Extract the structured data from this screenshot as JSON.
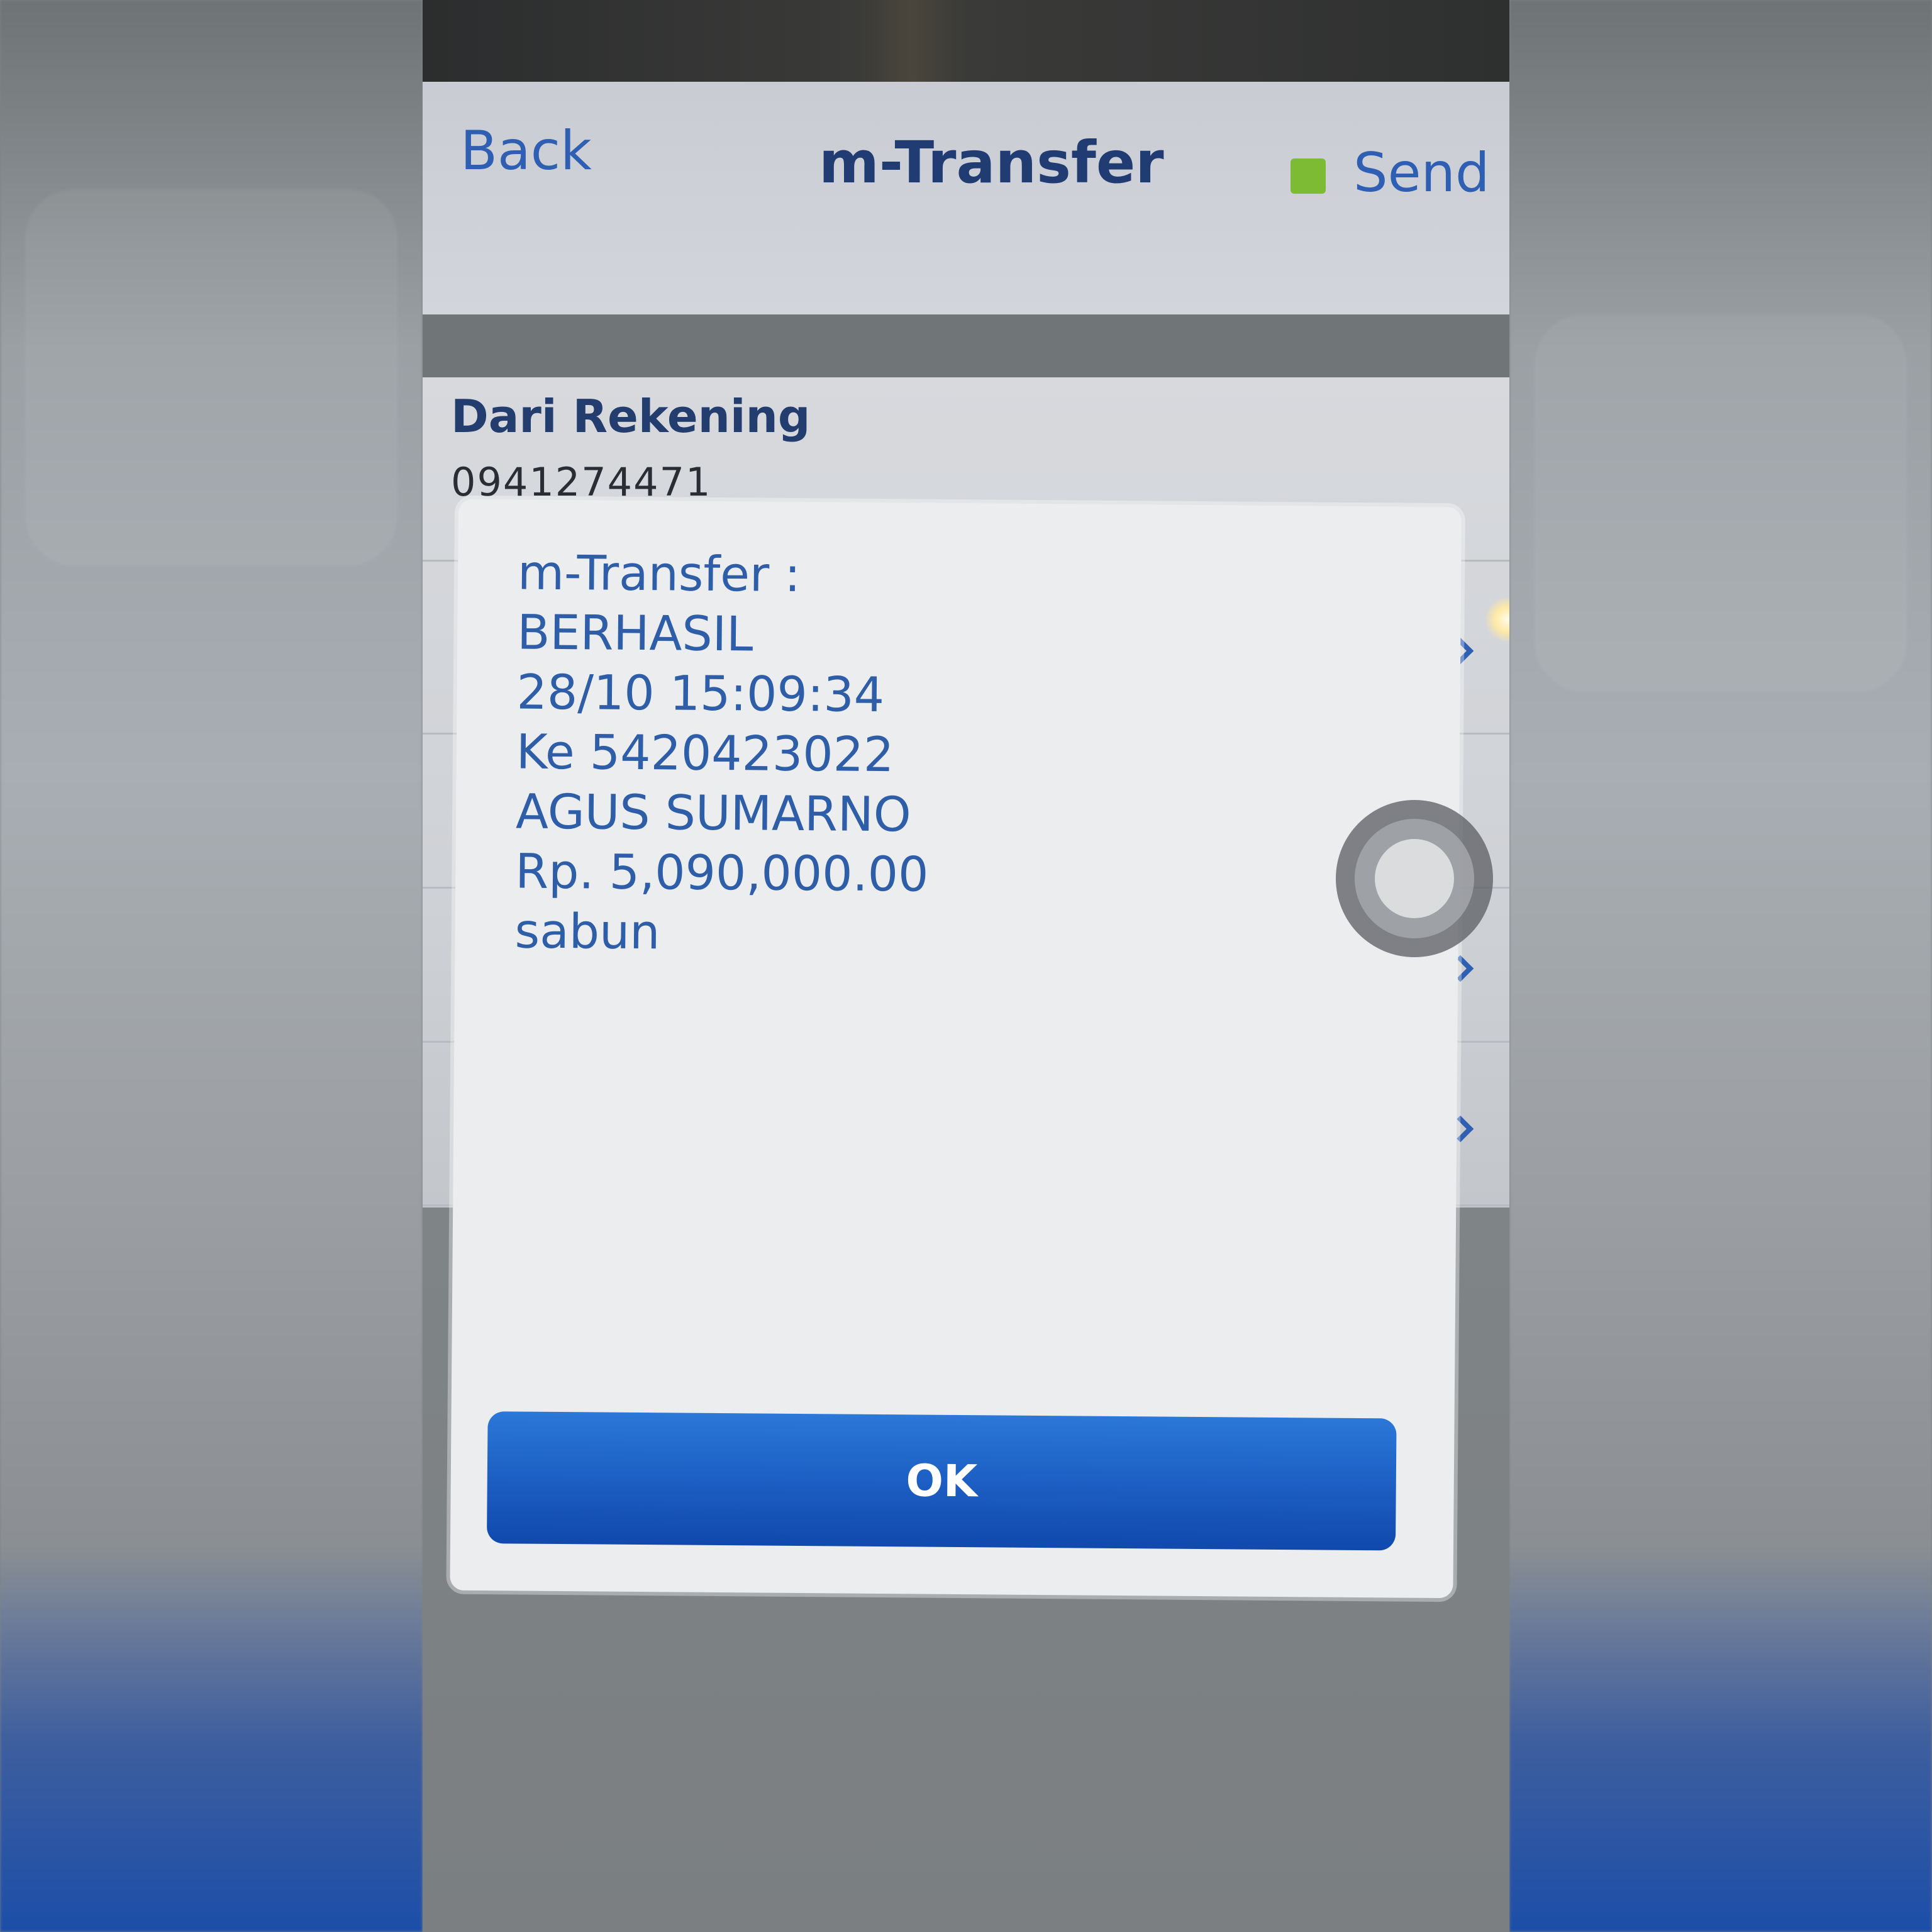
{
  "navbar": {
    "back_label": "Back",
    "title": "m-Transfer",
    "send_label": "Send",
    "status_dot_color": "#7dbb35"
  },
  "form": {
    "from_account_label": "Dari Rekening",
    "from_account_value": "0941274471"
  },
  "dialog": {
    "lines": [
      "m-Transfer :",
      "BERHASIL",
      "28/10 15:09:34",
      "Ke 5420423022",
      "AGUS SUMARNO",
      "Rp. 5,090,000.00",
      "sabun"
    ],
    "ok_label": "OK"
  },
  "colors": {
    "accent": "#2f5fb3",
    "button": "#1d5fc4"
  }
}
